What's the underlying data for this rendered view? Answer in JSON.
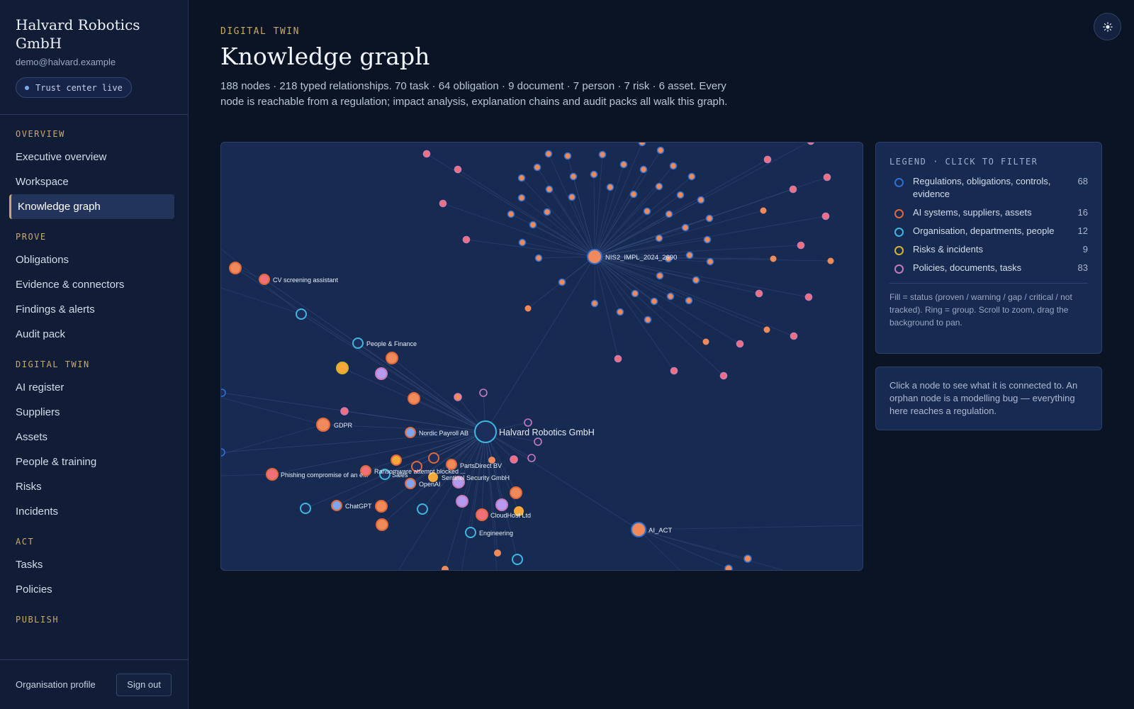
{
  "sidebar": {
    "org_name": "Halvard Robotics GmbH",
    "email": "demo@halvard.example",
    "trust_label": "Trust center live",
    "sections": [
      {
        "title": "OVERVIEW",
        "items": [
          "Executive overview",
          "Workspace",
          "Knowledge graph"
        ]
      },
      {
        "title": "PROVE",
        "items": [
          "Obligations",
          "Evidence & connectors",
          "Findings & alerts",
          "Audit pack"
        ]
      },
      {
        "title": "DIGITAL TWIN",
        "items": [
          "AI register",
          "Suppliers",
          "Assets",
          "People & training",
          "Risks",
          "Incidents"
        ]
      },
      {
        "title": "ACT",
        "items": [
          "Tasks",
          "Policies"
        ]
      },
      {
        "title": "PUBLISH",
        "items": []
      }
    ],
    "active_item": "Knowledge graph",
    "footer": {
      "profile_link": "Organisation profile",
      "signout_label": "Sign out"
    }
  },
  "header": {
    "eyebrow": "DIGITAL TWIN",
    "title": "Knowledge graph",
    "description": "188 nodes · 218 typed relationships. 70 task · 64 obligation · 9 document · 7 person · 7 risk · 6 asset. Every node is reachable from a regulation; impact analysis, explanation chains and audit packs all walk this graph.",
    "theme_icon": "sun-icon"
  },
  "legend": {
    "title": "LEGEND · CLICK TO FILTER",
    "items": [
      {
        "label": "Regulations, obligations, controls, evidence",
        "count": "68",
        "color": "#2f6fd1"
      },
      {
        "label": "AI systems, suppliers, assets",
        "count": "16",
        "color": "#e0683a"
      },
      {
        "label": "Organisation, departments, people",
        "count": "12",
        "color": "#3fb6e0"
      },
      {
        "label": "Risks & incidents",
        "count": "9",
        "color": "#d6b231"
      },
      {
        "label": "Policies, documents, tasks",
        "count": "83",
        "color": "#c97ab8"
      }
    ],
    "note": "Fill = status (proven / warning / gap / critical / not tracked). Ring = group. Scroll to zoom, drag the background to pan."
  },
  "info": {
    "text": "Click a node to see what it is connected to. An orphan node is a modelling bug — everything here reaches a regulation."
  },
  "graph": {
    "labels": {
      "hub": "Halvard Robotics GmbH",
      "nis2": "NIS2_IMPL_2024_2690",
      "cv": "CV screening assistant",
      "people_finance": "People & Finance",
      "gdpr": "GDPR",
      "nordic": "Nordic Payroll AB",
      "partsdirect": "PartsDirect BV",
      "phishing": "Phishing compromise of an e...",
      "ransomware": "Ransomware attempt blocked ...",
      "sales": "Sales",
      "sentinel": "Sentinel Security GmbH",
      "openai": "OpenAI",
      "chatgpt": "ChatGPT",
      "cloudhost": "CloudHost Ltd",
      "engineering": "Engineering",
      "aiact": "AI_ACT"
    },
    "colors": {
      "edge": "#3a5488",
      "fill_warning": "#f08a5a",
      "fill_gap": "#f0707a",
      "fill_amber": "#f6a83a",
      "fill_proven": "#7ea6f0",
      "fill_purple": "#b49af0",
      "ring_blue": "#2f6fd1",
      "ring_orange": "#e0683a",
      "ring_cyan": "#3fb6e0",
      "ring_yellow": "#d6b231",
      "ring_pink": "#c97ab8"
    }
  }
}
